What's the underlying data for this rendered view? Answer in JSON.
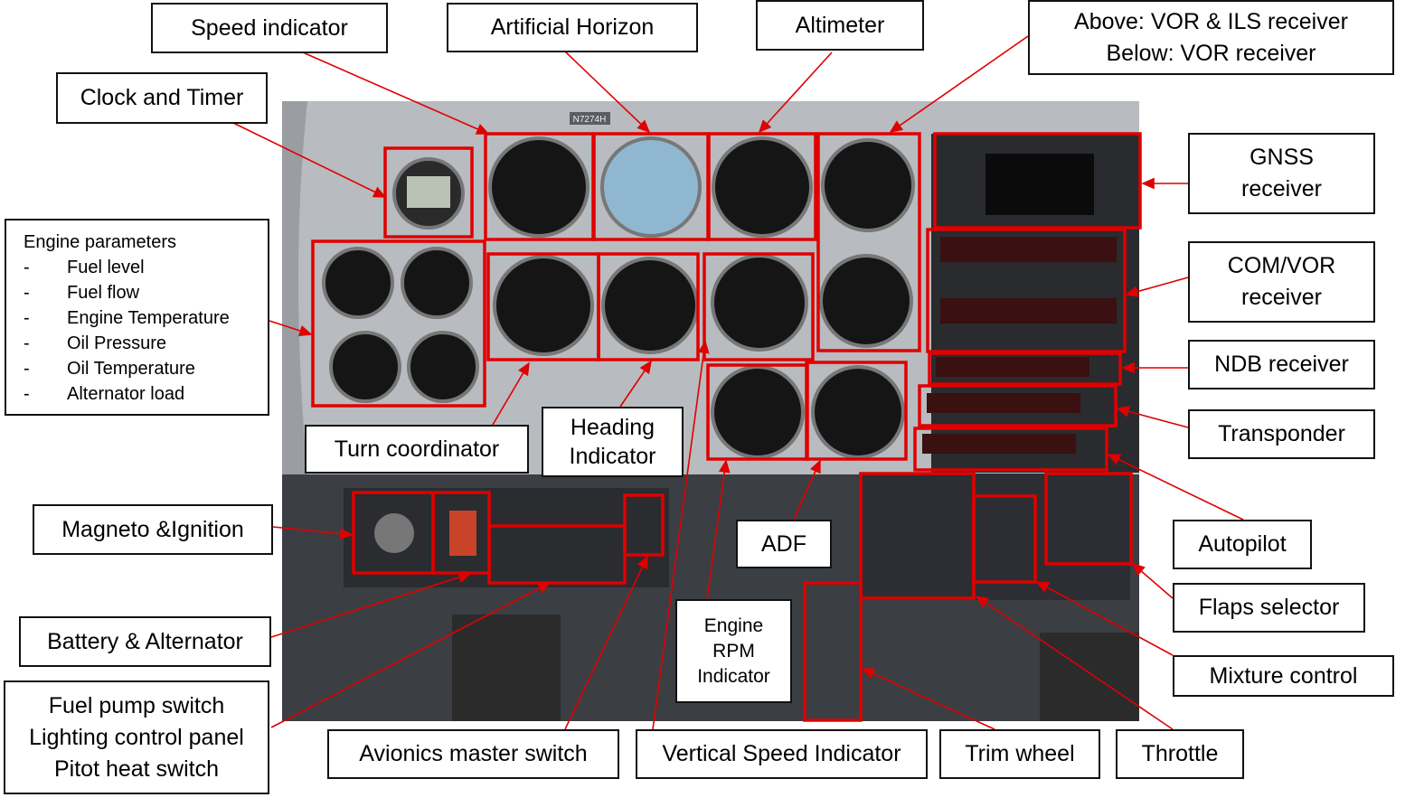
{
  "labels": {
    "speed_indicator": "Speed indicator",
    "artificial_horizon": "Artificial Horizon",
    "altimeter": "Altimeter",
    "vor_ils_line1": "Above: VOR & ILS receiver",
    "vor_ils_line2": "Below: VOR receiver",
    "clock_timer": "Clock and Timer",
    "gnss_line1": "GNSS",
    "gnss_line2": "receiver",
    "comvor_line1": "COM/VOR",
    "comvor_line2": "receiver",
    "ndb": "NDB receiver",
    "transponder": "Transponder",
    "turn_coordinator": "Turn coordinator",
    "heading_line1": "Heading",
    "heading_line2": "Indicator",
    "magneto": "Magneto &Ignition",
    "adf": "ADF",
    "autopilot": "Autopilot",
    "flaps": "Flaps selector",
    "rpm_line1": "Engine",
    "rpm_line2": "RPM",
    "rpm_line3": "Indicator",
    "battery": "Battery & Alternator",
    "mixture": "Mixture control",
    "fuelpump_line1": "Fuel pump switch",
    "fuelpump_line2": "Lighting control panel",
    "fuelpump_line3": "Pitot heat switch",
    "avionics": "Avionics master switch",
    "vsi": "Vertical Speed Indicator",
    "trim": "Trim wheel",
    "throttle": "Throttle"
  },
  "engine_parameters": {
    "title": "Engine parameters",
    "dash": "-",
    "items": [
      "Fuel level",
      "Fuel flow",
      "Engine Temperature",
      "Oil Pressure",
      "Oil Temperature",
      "Alternator load"
    ]
  },
  "panel": {
    "tail_number": "N7274H"
  },
  "colors": {
    "highlight": "#e00000",
    "panel": "#b8bbbf",
    "lower_panel": "#3b3e43"
  }
}
